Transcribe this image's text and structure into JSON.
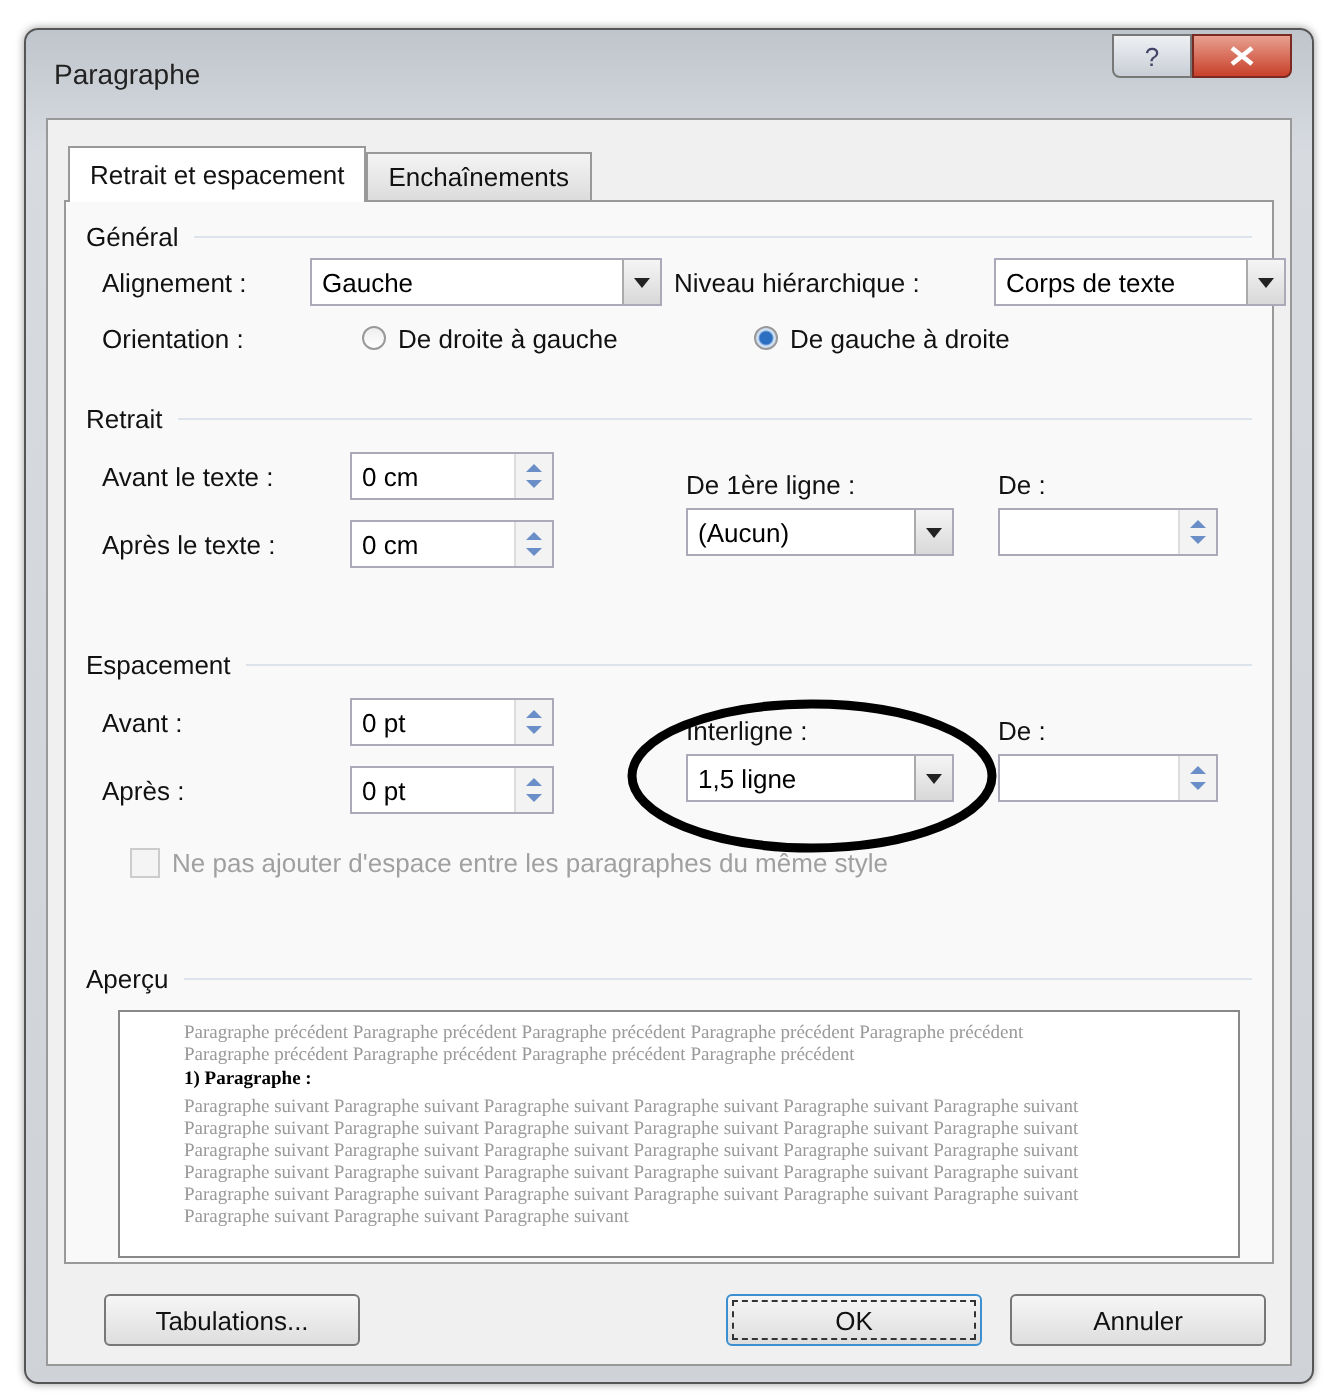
{
  "window": {
    "title": "Paragraphe",
    "help": "?"
  },
  "tabs": [
    {
      "label": "Retrait et espacement",
      "selected": true
    },
    {
      "label": "Enchaînements",
      "selected": false
    }
  ],
  "general": {
    "title": "Général",
    "alignment": {
      "label": "Alignement :",
      "value": "Gauche"
    },
    "outline_level": {
      "label": "Niveau hiérarchique :",
      "value": "Corps de texte"
    },
    "orientation": {
      "label": "Orientation :",
      "options": [
        {
          "label": "De droite à gauche",
          "selected": false
        },
        {
          "label": "De gauche à droite",
          "selected": true
        }
      ]
    }
  },
  "indent": {
    "title": "Retrait",
    "before": {
      "label": "Avant le texte :",
      "value": "0 cm"
    },
    "after": {
      "label": "Après le texte :",
      "value": "0 cm"
    },
    "first_line": {
      "label": "De 1ère ligne :",
      "value": "(Aucun)"
    },
    "by": {
      "label": "De :"
    }
  },
  "spacing": {
    "title": "Espacement",
    "before": {
      "label": "Avant :",
      "value": "0 pt"
    },
    "after": {
      "label": "Après :",
      "value": "0 pt"
    },
    "line_spacing": {
      "label": "Interligne :",
      "value": "1,5 ligne"
    },
    "at": {
      "label": "De :"
    },
    "no_space": {
      "label": "Ne pas ajouter d'espace entre les paragraphes du même style",
      "checked": false,
      "disabled": true
    }
  },
  "preview": {
    "title": "Aperçu",
    "previous": "Paragraphe précédent Paragraphe précédent Paragraphe précédent Paragraphe précédent Paragraphe précédent Paragraphe précédent Paragraphe précédent Paragraphe précédent Paragraphe précédent",
    "heading": "1) Paragraphe :",
    "following": "Paragraphe suivant Paragraphe suivant Paragraphe suivant Paragraphe suivant Paragraphe suivant Paragraphe suivant Paragraphe suivant Paragraphe suivant Paragraphe suivant Paragraphe suivant Paragraphe suivant Paragraphe suivant Paragraphe suivant Paragraphe suivant Paragraphe suivant Paragraphe suivant Paragraphe suivant Paragraphe suivant Paragraphe suivant Paragraphe suivant Paragraphe suivant Paragraphe suivant Paragraphe suivant Paragraphe suivant Paragraphe suivant Paragraphe suivant Paragraphe suivant Paragraphe suivant Paragraphe suivant Paragraphe suivant Paragraphe suivant Paragraphe suivant Paragraphe suivant"
  },
  "buttons": [
    {
      "label": "Tabulations...",
      "default": false
    },
    {
      "label": "OK",
      "default": true
    },
    {
      "label": "Annuler",
      "default": false
    }
  ]
}
